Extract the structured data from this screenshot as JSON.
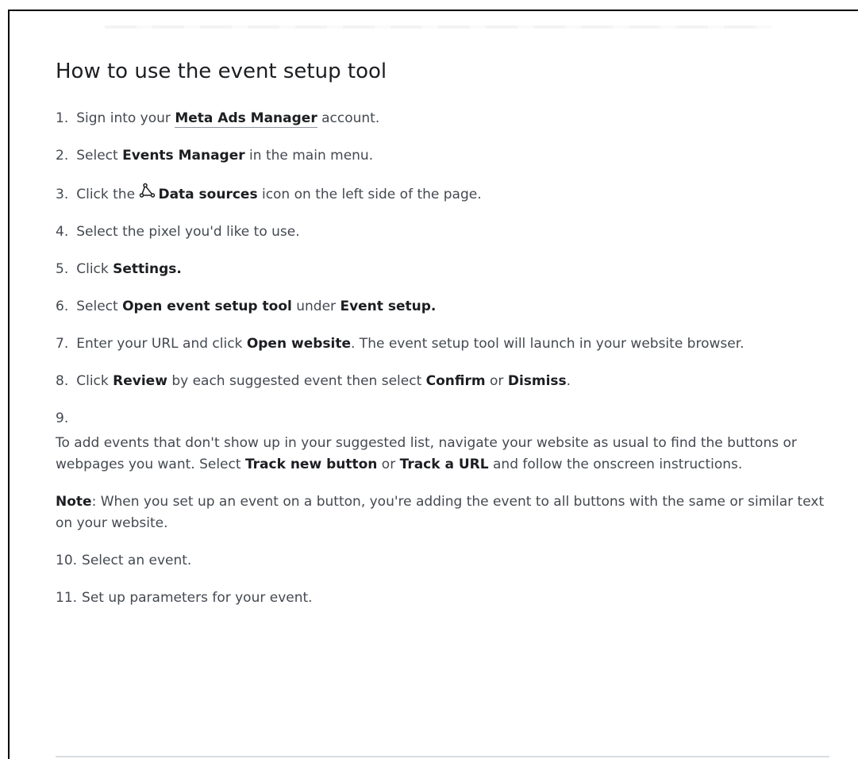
{
  "title": "How to use the event setup tool",
  "steps": [
    {
      "num": "1.",
      "pre": "Sign into your ",
      "link": "Meta Ads Manager",
      "post": " account."
    },
    {
      "num": "2.",
      "pre": "Select ",
      "bold": "Events Manager",
      "post": " in the main menu."
    },
    {
      "num": "3.",
      "pre": "Click the ",
      "bold": "Data sources",
      "post": " icon on the left side of the page.",
      "icon": "data-sources-icon"
    },
    {
      "num": "4.",
      "text": "Select the pixel you'd like to use."
    },
    {
      "num": "5.",
      "pre": "Click ",
      "bold": "Settings."
    },
    {
      "num": "6.",
      "pre": "Select ",
      "bold": "Open event setup tool",
      "mid": " under ",
      "bold2": "Event setup."
    },
    {
      "num": "7.",
      "pre": "Enter your URL and click ",
      "bold": "Open website",
      "post": ". The event setup tool will launch in your website browser."
    },
    {
      "num": "8.",
      "pre": "Click ",
      "bold": "Review",
      "mid": " by each suggested event then select ",
      "bold2": "Confirm",
      "mid2": " or ",
      "bold3": "Dismiss",
      "post": "."
    },
    {
      "num": "9.",
      "pre": "To add events that don't show up in your suggested list, navigate your website as usual to find the buttons or webpages you want. Select ",
      "bold": "Track new button",
      "mid": " or ",
      "bold2": "Track a URL",
      "post": " and follow the onscreen instructions."
    },
    {
      "num": "10.",
      "text": "Select an event."
    },
    {
      "num": "11.",
      "text": "Set up parameters for your event."
    }
  ],
  "note": {
    "label": "Note",
    "text": ": When you set up an event on a button, you're adding the event to all buttons with the same or similar text on your website."
  }
}
